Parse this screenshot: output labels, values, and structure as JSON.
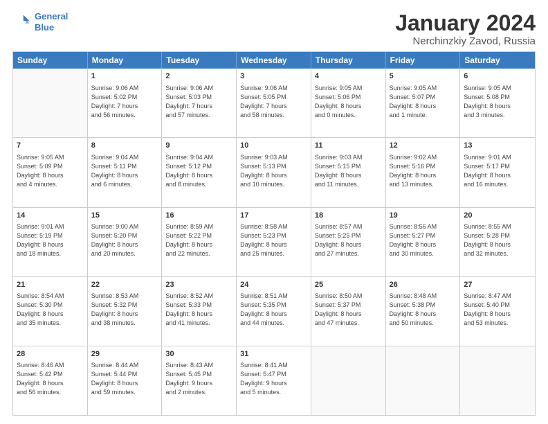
{
  "header": {
    "logo_line1": "General",
    "logo_line2": "Blue",
    "title": "January 2024",
    "subtitle": "Nerchinzkiy Zavod, Russia"
  },
  "days": [
    "Sunday",
    "Monday",
    "Tuesday",
    "Wednesday",
    "Thursday",
    "Friday",
    "Saturday"
  ],
  "weeks": [
    [
      {
        "day": "",
        "info": ""
      },
      {
        "day": "1",
        "info": "Sunrise: 9:06 AM\nSunset: 5:02 PM\nDaylight: 7 hours\nand 56 minutes."
      },
      {
        "day": "2",
        "info": "Sunrise: 9:06 AM\nSunset: 5:03 PM\nDaylight: 7 hours\nand 57 minutes."
      },
      {
        "day": "3",
        "info": "Sunrise: 9:06 AM\nSunset: 5:05 PM\nDaylight: 7 hours\nand 58 minutes."
      },
      {
        "day": "4",
        "info": "Sunrise: 9:05 AM\nSunset: 5:06 PM\nDaylight: 8 hours\nand 0 minutes."
      },
      {
        "day": "5",
        "info": "Sunrise: 9:05 AM\nSunset: 5:07 PM\nDaylight: 8 hours\nand 1 minute."
      },
      {
        "day": "6",
        "info": "Sunrise: 9:05 AM\nSunset: 5:08 PM\nDaylight: 8 hours\nand 3 minutes."
      }
    ],
    [
      {
        "day": "7",
        "info": "Sunrise: 9:05 AM\nSunset: 5:09 PM\nDaylight: 8 hours\nand 4 minutes."
      },
      {
        "day": "8",
        "info": "Sunrise: 9:04 AM\nSunset: 5:11 PM\nDaylight: 8 hours\nand 6 minutes."
      },
      {
        "day": "9",
        "info": "Sunrise: 9:04 AM\nSunset: 5:12 PM\nDaylight: 8 hours\nand 8 minutes."
      },
      {
        "day": "10",
        "info": "Sunrise: 9:03 AM\nSunset: 5:13 PM\nDaylight: 8 hours\nand 10 minutes."
      },
      {
        "day": "11",
        "info": "Sunrise: 9:03 AM\nSunset: 5:15 PM\nDaylight: 8 hours\nand 11 minutes."
      },
      {
        "day": "12",
        "info": "Sunrise: 9:02 AM\nSunset: 5:16 PM\nDaylight: 8 hours\nand 13 minutes."
      },
      {
        "day": "13",
        "info": "Sunrise: 9:01 AM\nSunset: 5:17 PM\nDaylight: 8 hours\nand 16 minutes."
      }
    ],
    [
      {
        "day": "14",
        "info": "Sunrise: 9:01 AM\nSunset: 5:19 PM\nDaylight: 8 hours\nand 18 minutes."
      },
      {
        "day": "15",
        "info": "Sunrise: 9:00 AM\nSunset: 5:20 PM\nDaylight: 8 hours\nand 20 minutes."
      },
      {
        "day": "16",
        "info": "Sunrise: 8:59 AM\nSunset: 5:22 PM\nDaylight: 8 hours\nand 22 minutes."
      },
      {
        "day": "17",
        "info": "Sunrise: 8:58 AM\nSunset: 5:23 PM\nDaylight: 8 hours\nand 25 minutes."
      },
      {
        "day": "18",
        "info": "Sunrise: 8:57 AM\nSunset: 5:25 PM\nDaylight: 8 hours\nand 27 minutes."
      },
      {
        "day": "19",
        "info": "Sunrise: 8:56 AM\nSunset: 5:27 PM\nDaylight: 8 hours\nand 30 minutes."
      },
      {
        "day": "20",
        "info": "Sunrise: 8:55 AM\nSunset: 5:28 PM\nDaylight: 8 hours\nand 32 minutes."
      }
    ],
    [
      {
        "day": "21",
        "info": "Sunrise: 8:54 AM\nSunset: 5:30 PM\nDaylight: 8 hours\nand 35 minutes."
      },
      {
        "day": "22",
        "info": "Sunrise: 8:53 AM\nSunset: 5:32 PM\nDaylight: 8 hours\nand 38 minutes."
      },
      {
        "day": "23",
        "info": "Sunrise: 8:52 AM\nSunset: 5:33 PM\nDaylight: 8 hours\nand 41 minutes."
      },
      {
        "day": "24",
        "info": "Sunrise: 8:51 AM\nSunset: 5:35 PM\nDaylight: 8 hours\nand 44 minutes."
      },
      {
        "day": "25",
        "info": "Sunrise: 8:50 AM\nSunset: 5:37 PM\nDaylight: 8 hours\nand 47 minutes."
      },
      {
        "day": "26",
        "info": "Sunrise: 8:48 AM\nSunset: 5:38 PM\nDaylight: 8 hours\nand 50 minutes."
      },
      {
        "day": "27",
        "info": "Sunrise: 8:47 AM\nSunset: 5:40 PM\nDaylight: 8 hours\nand 53 minutes."
      }
    ],
    [
      {
        "day": "28",
        "info": "Sunrise: 8:46 AM\nSunset: 5:42 PM\nDaylight: 8 hours\nand 56 minutes."
      },
      {
        "day": "29",
        "info": "Sunrise: 8:44 AM\nSunset: 5:44 PM\nDaylight: 8 hours\nand 59 minutes."
      },
      {
        "day": "30",
        "info": "Sunrise: 8:43 AM\nSunset: 5:45 PM\nDaylight: 9 hours\nand 2 minutes."
      },
      {
        "day": "31",
        "info": "Sunrise: 8:41 AM\nSunset: 5:47 PM\nDaylight: 9 hours\nand 5 minutes."
      },
      {
        "day": "",
        "info": ""
      },
      {
        "day": "",
        "info": ""
      },
      {
        "day": "",
        "info": ""
      }
    ]
  ]
}
